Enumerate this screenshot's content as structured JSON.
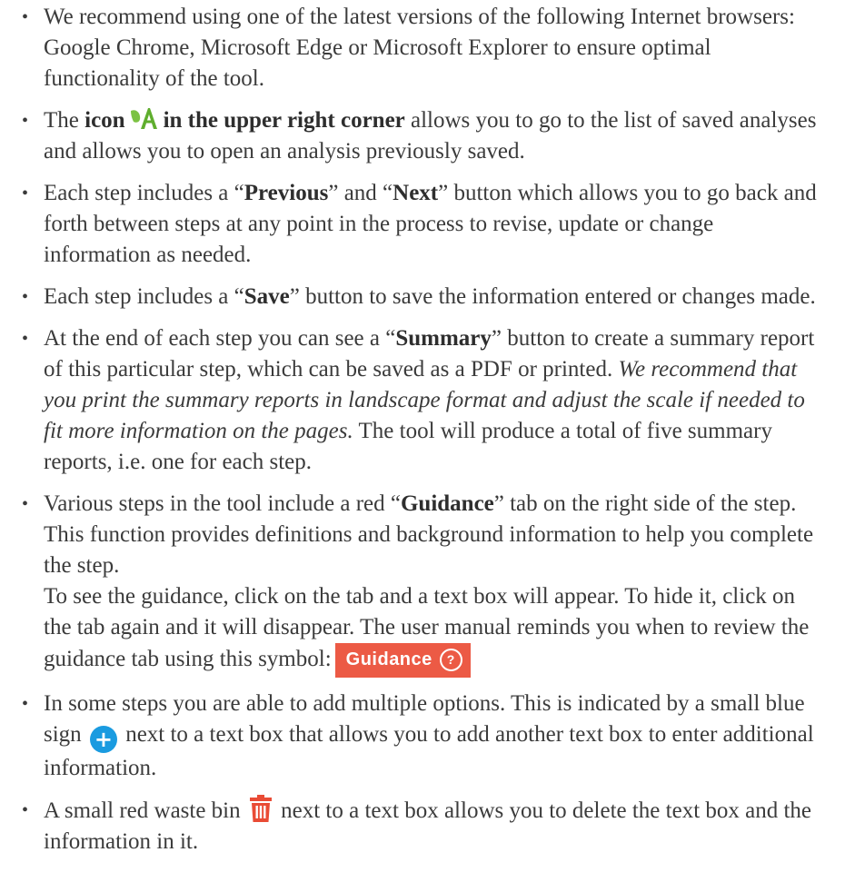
{
  "bullets": {
    "b1": {
      "text": "We recommend using one of the latest versions of the following Internet browsers: Google Chrome, Microsoft Edge or Microsoft Explorer to ensure optimal functionality of the tool."
    },
    "b2": {
      "pre": "The ",
      "bold1": "icon",
      "bold2": "in the upper right corner",
      "post": " allows you to go to the list of saved analyses and allows you to open an analysis previously saved.",
      "icon": "leaf-logo-icon"
    },
    "b3": {
      "pre": "Each step includes a “",
      "bold1": "Previous",
      "mid": "” and “",
      "bold2": "Next",
      "post": "” button which allows you to go back and forth between steps at any point in the process to revise, update or change information as needed."
    },
    "b4": {
      "pre": "Each step includes a “",
      "bold1": "Save",
      "post": "” button to save the information entered or changes made."
    },
    "b5": {
      "pre": "At the end of each step you can see a “",
      "bold1": "Summary",
      "mid": "” button to create a summary report of this particular step, which can be saved as a PDF or printed. ",
      "italic": "We recommend that you print the summary reports in landscape format and adjust the scale if needed to fit more information on the pages.",
      "post": " The tool will produce a total of five summary reports, i.e. one for each step."
    },
    "b6": {
      "pre": "Various steps in the tool include a red “",
      "bold1": "Guidance",
      "mid": "” tab on the right side of the step. This function provides definitions and background information to help you complete the step.",
      "para2": "To see the guidance, click on the tab and a text box will appear. To hide it, click on the tab again and it will disappear. The user manual reminds you when to review the guidance tab using this symbol:",
      "badge_label": "Guidance",
      "badge_q": "?"
    },
    "b7": {
      "pre": "In some steps you are able to add multiple options. This is indicated by a small blue sign",
      "post": " next to a text box that allows you to add another text box to enter additional information.",
      "icon": "plus-circle-icon"
    },
    "b8": {
      "pre": "A small red waste bin",
      "post": " next to a text box allows you to delete the text box and the information in it.",
      "icon": "trash-bin-icon"
    }
  },
  "colors": {
    "text": "#3b3b3b",
    "guidance_red": "#ec5a45",
    "plus_blue": "#1a9be0",
    "bin_red": "#e94b35",
    "leaf_green": "#7cc243"
  }
}
